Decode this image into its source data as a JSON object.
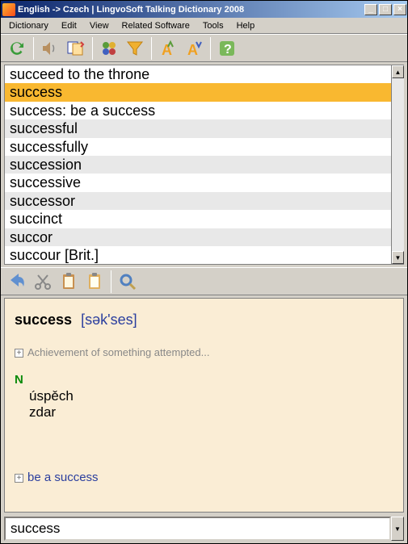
{
  "titlebar": {
    "text": "English -> Czech | LingvoSoft Talking Dictionary 2008",
    "buttons": {
      "min": "_",
      "max": "□",
      "close": "×"
    }
  },
  "menu": [
    "Dictionary",
    "Edit",
    "View",
    "Related Software",
    "Tools",
    "Help"
  ],
  "wordlist": [
    {
      "text": "succeed to the throne",
      "selected": false,
      "alt": false
    },
    {
      "text": "success",
      "selected": true,
      "alt": false
    },
    {
      "text": "success: be a success",
      "selected": false,
      "alt": false
    },
    {
      "text": "successful",
      "selected": false,
      "alt": true
    },
    {
      "text": "successfully",
      "selected": false,
      "alt": false
    },
    {
      "text": "succession",
      "selected": false,
      "alt": true
    },
    {
      "text": "successive",
      "selected": false,
      "alt": false
    },
    {
      "text": "successor",
      "selected": false,
      "alt": true
    },
    {
      "text": "succinct",
      "selected": false,
      "alt": false
    },
    {
      "text": "succor",
      "selected": false,
      "alt": true
    },
    {
      "text": "succour [Brit.]",
      "selected": false,
      "alt": false
    }
  ],
  "entry": {
    "headword": "success",
    "phonetic": "[sək'ses]",
    "definition": "Achievement of something attempted...",
    "pos": "N",
    "translations": [
      "úspěch",
      "zdar"
    ],
    "related": "be a success"
  },
  "search": {
    "value": "success"
  },
  "scroll": {
    "up": "▲",
    "down": "▼"
  }
}
